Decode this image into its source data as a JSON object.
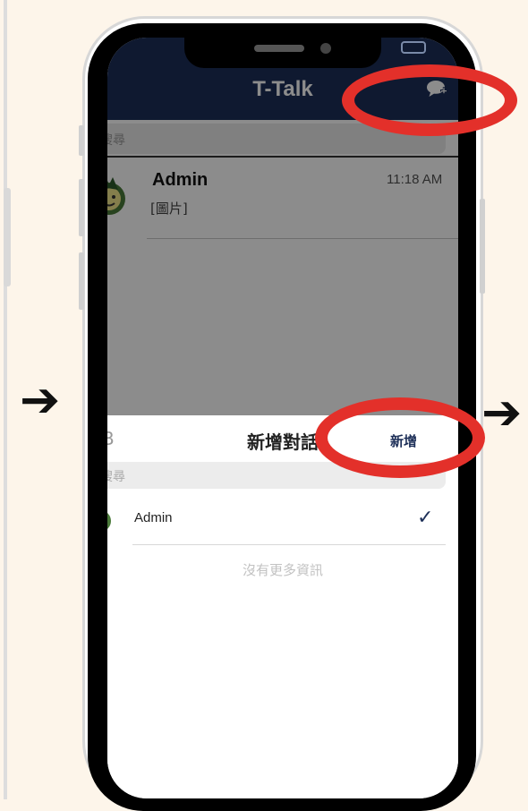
{
  "app": {
    "title": "T-Talk"
  },
  "search": {
    "placeholder": "搜尋"
  },
  "chat_list": [
    {
      "name": "Admin",
      "time": "11:18 AM",
      "preview": "[圖片]"
    }
  ],
  "new_chat_sheet": {
    "left_label": "B",
    "title": "新增對話",
    "add_label": "新增",
    "search_placeholder": "搜尋",
    "contacts": [
      {
        "name": "Admin",
        "selected": true
      }
    ],
    "empty_message": "沒有更多資訊"
  },
  "colors": {
    "navbar": "#1d2f58",
    "highlight": "#e3302a",
    "background": "#fdf5ea"
  },
  "icons": {
    "compose": "compose-chat-icon",
    "check": "checkmark-icon",
    "arrow": "right-arrow-icon"
  }
}
